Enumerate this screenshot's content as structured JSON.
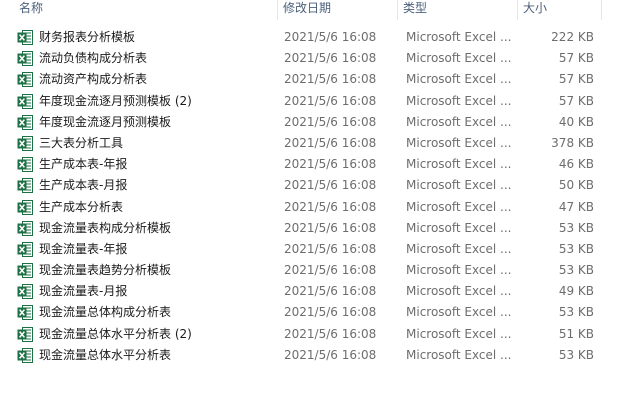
{
  "columns": {
    "name": "名称",
    "date": "修改日期",
    "type": "类型",
    "size": "大小"
  },
  "icon": "excel-file-icon",
  "colors": {
    "excel_green": "#1d7044",
    "header_text": "#4c607a",
    "meta_text": "#6d6d6d"
  },
  "files": [
    {
      "name": "财务报表分析模板",
      "date": "2021/5/6 16:08",
      "type": "Microsoft Excel ...",
      "size": "222 KB"
    },
    {
      "name": "流动负债构成分析表",
      "date": "2021/5/6 16:08",
      "type": "Microsoft Excel ...",
      "size": "57 KB"
    },
    {
      "name": "流动资产构成分析表",
      "date": "2021/5/6 16:08",
      "type": "Microsoft Excel ...",
      "size": "57 KB"
    },
    {
      "name": "年度现金流逐月预测模板 (2)",
      "date": "2021/5/6 16:08",
      "type": "Microsoft Excel ...",
      "size": "57 KB"
    },
    {
      "name": "年度现金流逐月预测模板",
      "date": "2021/5/6 16:08",
      "type": "Microsoft Excel ...",
      "size": "40 KB"
    },
    {
      "name": "三大表分析工具",
      "date": "2021/5/6 16:08",
      "type": "Microsoft Excel ...",
      "size": "378 KB"
    },
    {
      "name": "生产成本表-年报",
      "date": "2021/5/6 16:08",
      "type": "Microsoft Excel ...",
      "size": "46 KB"
    },
    {
      "name": "生产成本表-月报",
      "date": "2021/5/6 16:08",
      "type": "Microsoft Excel ...",
      "size": "50 KB"
    },
    {
      "name": "生产成本分析表",
      "date": "2021/5/6 16:08",
      "type": "Microsoft Excel ...",
      "size": "47 KB"
    },
    {
      "name": "现金流量表构成分析模板",
      "date": "2021/5/6 16:08",
      "type": "Microsoft Excel ...",
      "size": "53 KB"
    },
    {
      "name": "现金流量表-年报",
      "date": "2021/5/6 16:08",
      "type": "Microsoft Excel ...",
      "size": "53 KB"
    },
    {
      "name": "现金流量表趋势分析模板",
      "date": "2021/5/6 16:08",
      "type": "Microsoft Excel ...",
      "size": "53 KB"
    },
    {
      "name": "现金流量表-月报",
      "date": "2021/5/6 16:08",
      "type": "Microsoft Excel ...",
      "size": "49 KB"
    },
    {
      "name": "现金流量总体构成分析表",
      "date": "2021/5/6 16:08",
      "type": "Microsoft Excel ...",
      "size": "53 KB"
    },
    {
      "name": "现金流量总体水平分析表 (2)",
      "date": "2021/5/6 16:08",
      "type": "Microsoft Excel ...",
      "size": "51 KB"
    },
    {
      "name": "现金流量总体水平分析表",
      "date": "2021/5/6 16:08",
      "type": "Microsoft Excel ...",
      "size": "53 KB"
    }
  ]
}
